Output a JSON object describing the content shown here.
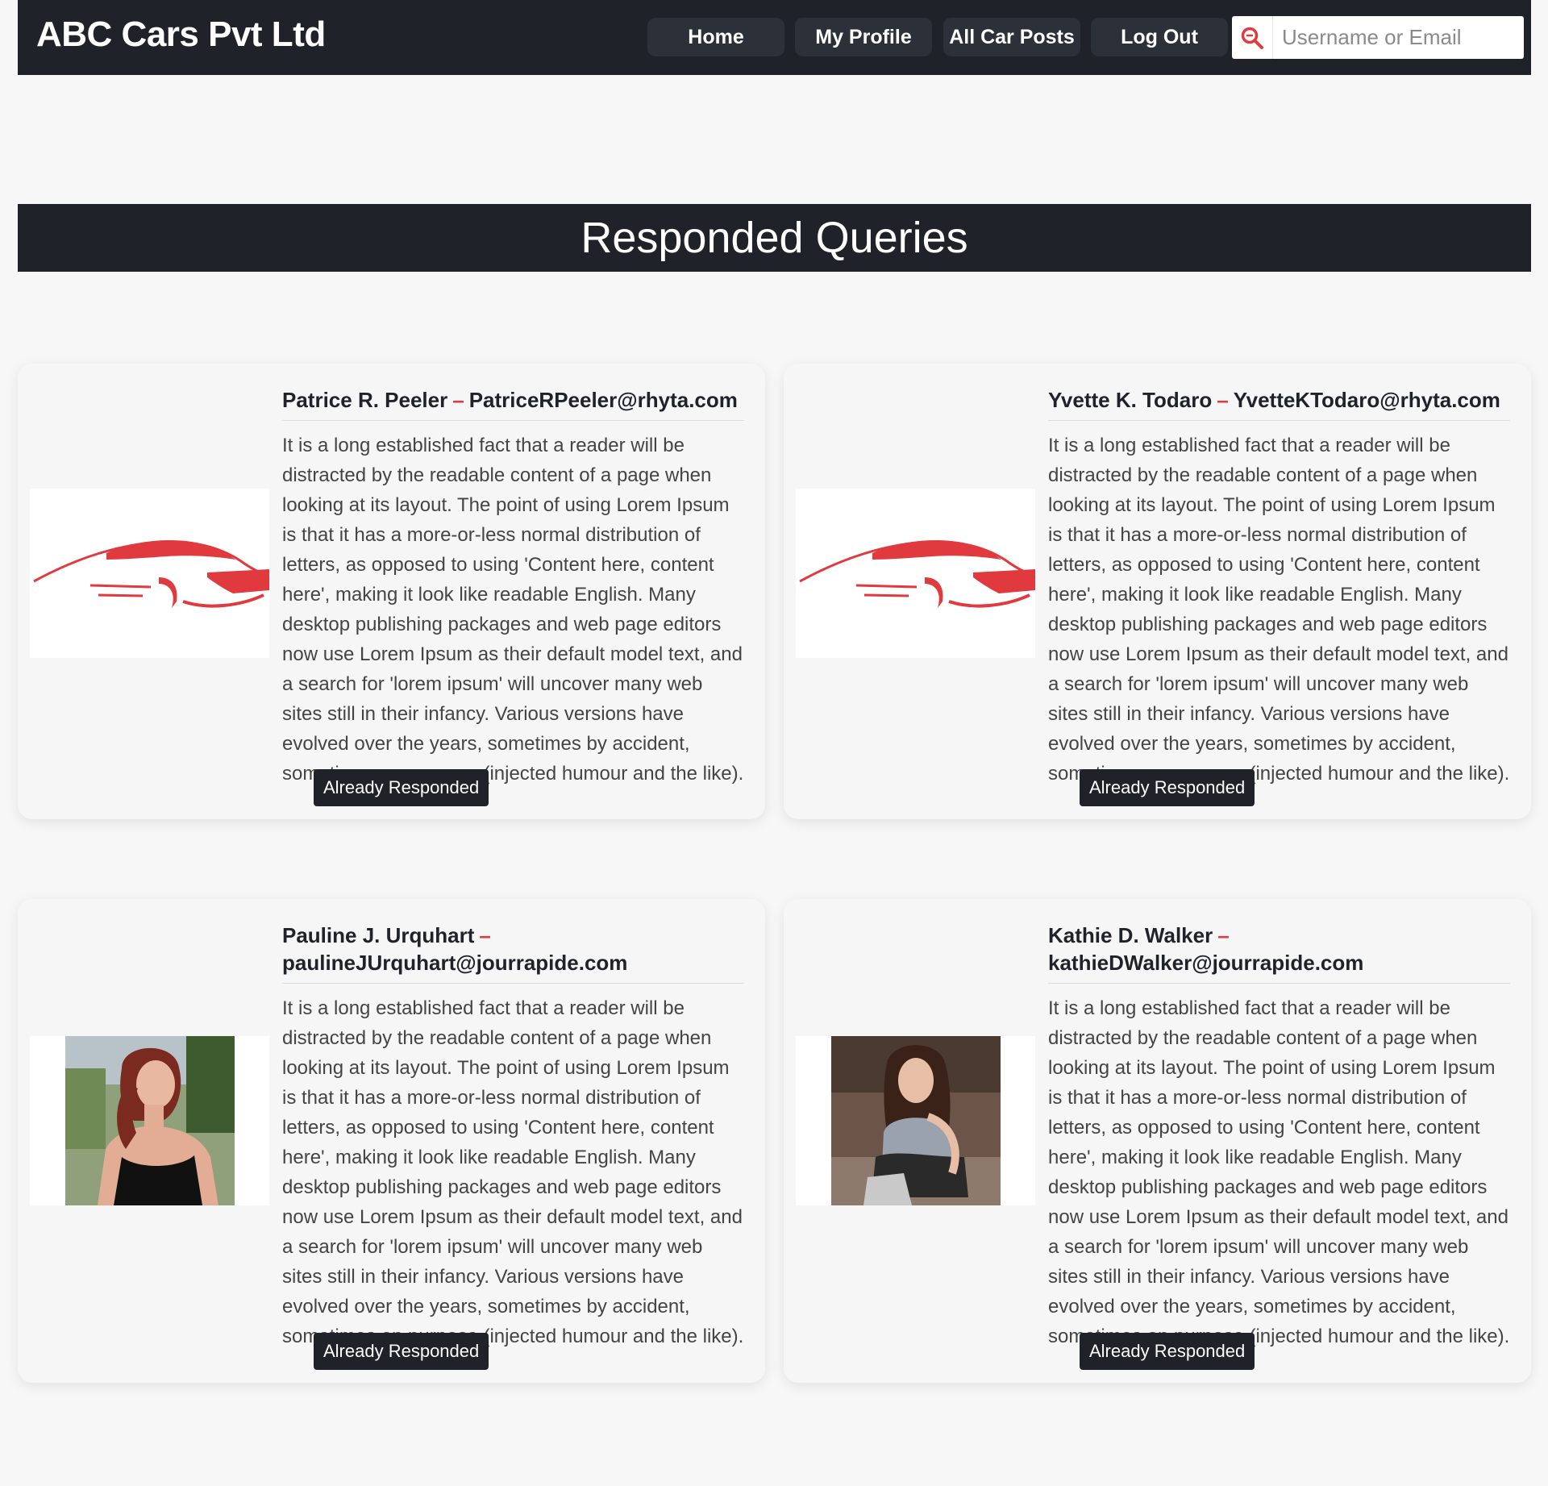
{
  "navbar": {
    "brand": "ABC Cars Pvt Ltd",
    "links": [
      "Home",
      "My Profile",
      "All Car Posts",
      "Log Out"
    ],
    "search_placeholder": "Username or Email",
    "accent_color": "#e0393e"
  },
  "page_title": "Responded Queries",
  "queries": [
    {
      "name": "Patrice R. Peeler",
      "email": "PatriceRPeeler@rhyta.com",
      "image": "red-car-logo",
      "message": "It is a long established fact that a reader will be distracted by the readable content of a page when looking at its layout. The point of using Lorem Ipsum is that it has a more-or-less normal distribution of letters, as opposed to using 'Content here, content here', making it look like readable English. Many desktop publishing packages and web page editors now use Lorem Ipsum as their default model text, and a search for 'lorem ipsum' will uncover many web sites still in their infancy. Various versions have evolved over the years, sometimes by accident, sometimes on purpose (injected humour and the like).",
      "status": "Already Responded"
    },
    {
      "name": "Yvette K. Todaro",
      "email": "YvetteKTodaro@rhyta.com",
      "image": "red-car-logo",
      "message": "It is a long established fact that a reader will be distracted by the readable content of a page when looking at its layout. The point of using Lorem Ipsum is that it has a more-or-less normal distribution of letters, as opposed to using 'Content here, content here', making it look like readable English. Many desktop publishing packages and web page editors now use Lorem Ipsum as their default model text, and a search for 'lorem ipsum' will uncover many web sites still in their infancy. Various versions have evolved over the years, sometimes by accident, sometimes on purpose (injected humour and the like).",
      "status": "Already Responded"
    },
    {
      "name": "Pauline J. Urquhart",
      "email": "paulineJUrquhart@jourrapide.com",
      "image": "woman-photo",
      "message": "It is a long established fact that a reader will be distracted by the readable content of a page when looking at its layout. The point of using Lorem Ipsum is that it has a more-or-less normal distribution of letters, as opposed to using 'Content here, content here', making it look like readable English. Many desktop publishing packages and web page editors now use Lorem Ipsum as their default model text, and a search for 'lorem ipsum' will uncover many web sites still in their infancy. Various versions have evolved over the years, sometimes by accident, sometimes on purpose (injected humour and the like).",
      "status": "Already Responded"
    },
    {
      "name": "Kathie D. Walker",
      "email": "kathieDWalker@jourrapide.com",
      "image": "woman-photo",
      "message": "It is a long established fact that a reader will be distracted by the readable content of a page when looking at its layout. The point of using Lorem Ipsum is that it has a more-or-less normal distribution of letters, as opposed to using 'Content here, content here', making it look like readable English. Many desktop publishing packages and web page editors now use Lorem Ipsum as their default model text, and a search for 'lorem ipsum' will uncover many web sites still in their infancy. Various versions have evolved over the years, sometimes by accident, sometimes on purpose (injected humour and the like).",
      "status": "Already Responded"
    }
  ]
}
